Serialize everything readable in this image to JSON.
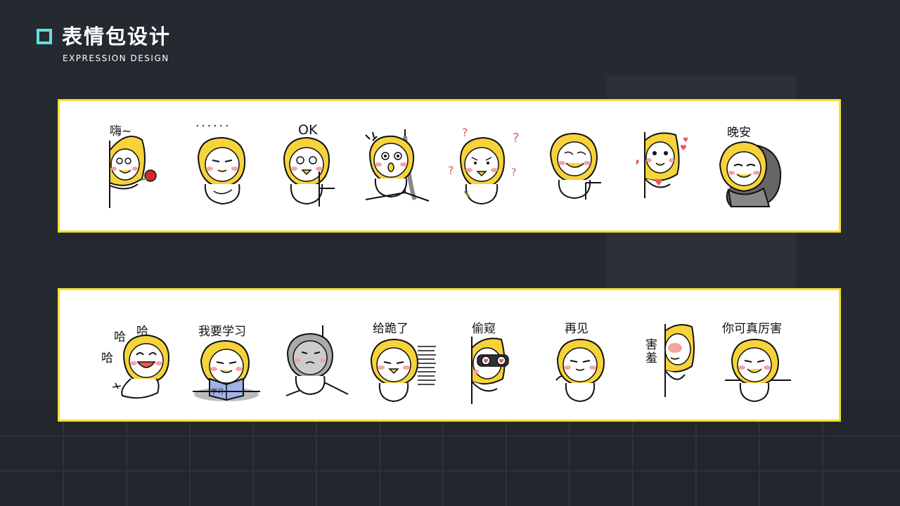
{
  "header": {
    "title": "表情包设计",
    "subtitle": "EXPRESSION DESIGN"
  },
  "colors": {
    "background": "#252a31",
    "accent_square": "#5ee0e3",
    "panel_border": "#f5df2e",
    "character_yellow": "#f7d33a",
    "cheek_pink": "#f6a3a3"
  },
  "row1": {
    "stickers": [
      {
        "caption": "嗨~"
      },
      {
        "caption": "······"
      },
      {
        "caption": "OK"
      },
      {
        "caption": ""
      },
      {
        "caption": ""
      },
      {
        "caption": ""
      },
      {
        "caption": ""
      },
      {
        "caption": "晚安"
      }
    ]
  },
  "row2": {
    "stickers": [
      {
        "caption_a": "哈",
        "caption_b": "哈",
        "caption_c": "哈"
      },
      {
        "caption": "我要学习",
        "book_text": "学习"
      },
      {
        "caption": ""
      },
      {
        "caption": "给跪了"
      },
      {
        "caption": "偷窥"
      },
      {
        "caption": "再见"
      },
      {
        "caption": "害羞"
      },
      {
        "caption": "你可真厉害"
      }
    ]
  }
}
